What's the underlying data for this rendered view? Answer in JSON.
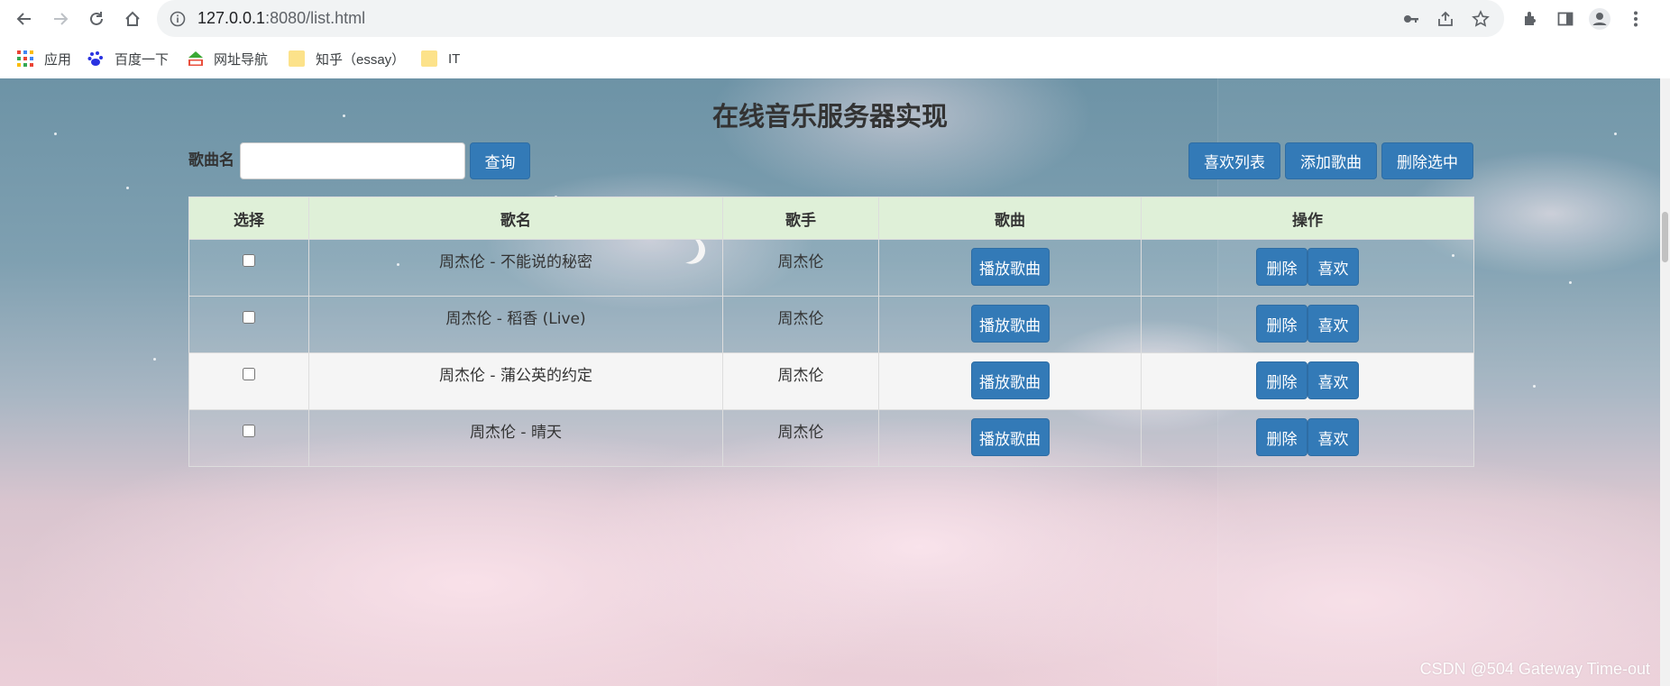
{
  "browser": {
    "url_host": "127.0.0.1",
    "url_path": ":8080/list.html",
    "bookmarks": [
      {
        "label": "应用",
        "icon": "apps-grid-icon"
      },
      {
        "label": "百度一下",
        "icon": "baidu-icon"
      },
      {
        "label": "网址导航",
        "icon": "hao123-icon"
      },
      {
        "label": "知乎（essay）",
        "icon": "folder-icon"
      },
      {
        "label": "IT",
        "icon": "folder-icon"
      }
    ]
  },
  "page": {
    "title": "在线音乐服务器实现",
    "search": {
      "label": "歌曲名",
      "value": "",
      "placeholder": "",
      "button": "查询"
    },
    "actions": {
      "favorites": "喜欢列表",
      "add": "添加歌曲",
      "delete_selected": "删除选中"
    },
    "table": {
      "headers": [
        "选择",
        "歌名",
        "歌手",
        "歌曲",
        "操作"
      ],
      "rows": [
        {
          "title": "周杰伦 - 不能说的秘密",
          "singer": "周杰伦",
          "checked": false
        },
        {
          "title": "周杰伦 - 稻香 (Live)",
          "singer": "周杰伦",
          "checked": false
        },
        {
          "title": "周杰伦 - 蒲公英的约定",
          "singer": "周杰伦",
          "checked": false
        },
        {
          "title": "周杰伦 - 晴天",
          "singer": "周杰伦",
          "checked": false
        }
      ],
      "play_label": "播放歌曲",
      "delete_label": "删除",
      "like_label": "喜欢"
    }
  },
  "watermark": "CSDN @504 Gateway Time-out",
  "colors": {
    "primary_button": "#337ab7",
    "table_header": "#dff0d8",
    "highlight_row": "#f5f5f5"
  }
}
